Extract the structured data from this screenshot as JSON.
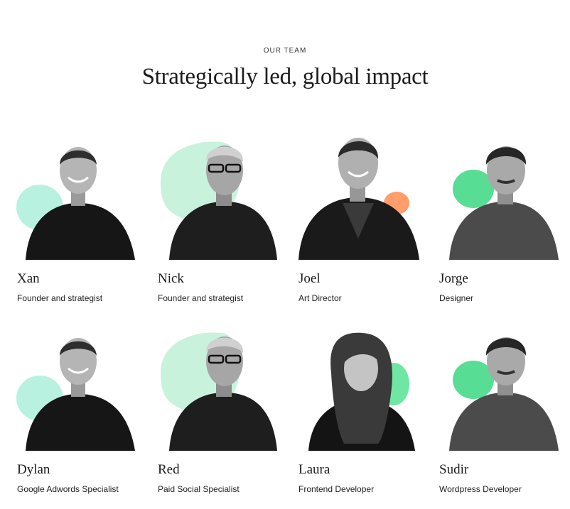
{
  "section": {
    "eyebrow": "OUR TEAM",
    "headline": "Strategically led, global impact"
  },
  "team": [
    {
      "name": "Xan",
      "role": "Founder and strategist",
      "blob_color": "#b8f1e0",
      "blob": "circle-left"
    },
    {
      "name": "Nick",
      "role": "Founder and strategist",
      "blob_color": "#c9f2dc",
      "blob": "large-organic"
    },
    {
      "name": "Joel",
      "role": "Art Director",
      "blob_color": "#ff9d6b",
      "blob": "small-right"
    },
    {
      "name": "Jorge",
      "role": "Designer",
      "blob_color": "#57dd94",
      "blob": "circle-left"
    },
    {
      "name": "Dylan",
      "role": "Google Adwords Specialist",
      "blob_color": "#b8f1e0",
      "blob": "circle-left"
    },
    {
      "name": "Red",
      "role": "Paid Social Specialist",
      "blob_color": "#c9f2dc",
      "blob": "large-organic"
    },
    {
      "name": "Laura",
      "role": "Frontend Developer",
      "blob_color": "#6fe6a3",
      "blob": "small-right"
    },
    {
      "name": "Sudir",
      "role": "Wordpress Developer",
      "blob_color": "#57dd94",
      "blob": "circle-left"
    }
  ]
}
